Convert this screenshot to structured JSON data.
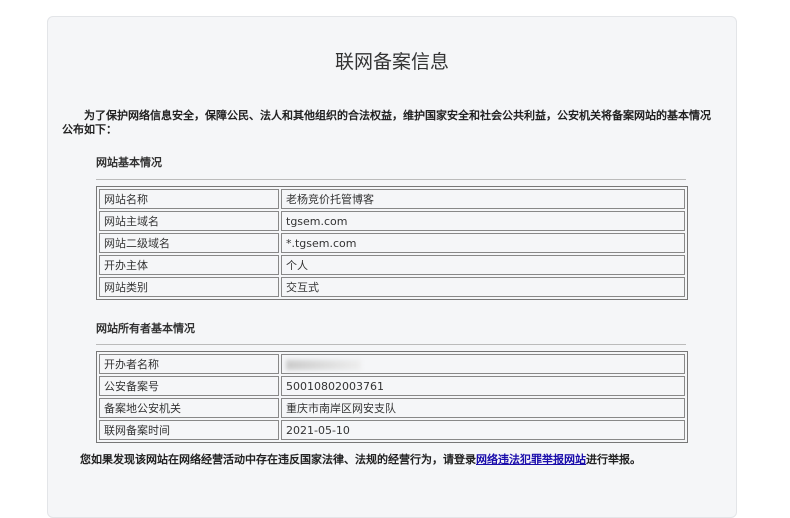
{
  "title": "联网备案信息",
  "intro": "为了保护网络信息安全，保障公民、法人和其他组织的合法权益，维护国家安全和社会公共利益，公安机关将备案网站的基本情况公布如下：",
  "section1": {
    "heading": "网站基本情况",
    "rows": [
      {
        "k": "网站名称",
        "v": "老杨竞价托管博客"
      },
      {
        "k": "网站主域名",
        "v": "tgsem.com"
      },
      {
        "k": "网站二级域名",
        "v": "*.tgsem.com"
      },
      {
        "k": "开办主体",
        "v": "个人"
      },
      {
        "k": "网站类别",
        "v": "交互式"
      }
    ]
  },
  "section2": {
    "heading": "网站所有者基本情况",
    "rows": [
      {
        "k": "开办者名称",
        "v": null
      },
      {
        "k": "公安备案号",
        "v": "50010802003761"
      },
      {
        "k": "备案地公安机关",
        "v": "重庆市南岸区网安支队"
      },
      {
        "k": "联网备案时间",
        "v": "2021-05-10"
      }
    ]
  },
  "footer": {
    "before": "您如果发现该网站在网络经营活动中存在违反国家法律、法规的经营行为，请登录",
    "link": "网络违法犯罪举报网站",
    "after": "进行举报。"
  }
}
